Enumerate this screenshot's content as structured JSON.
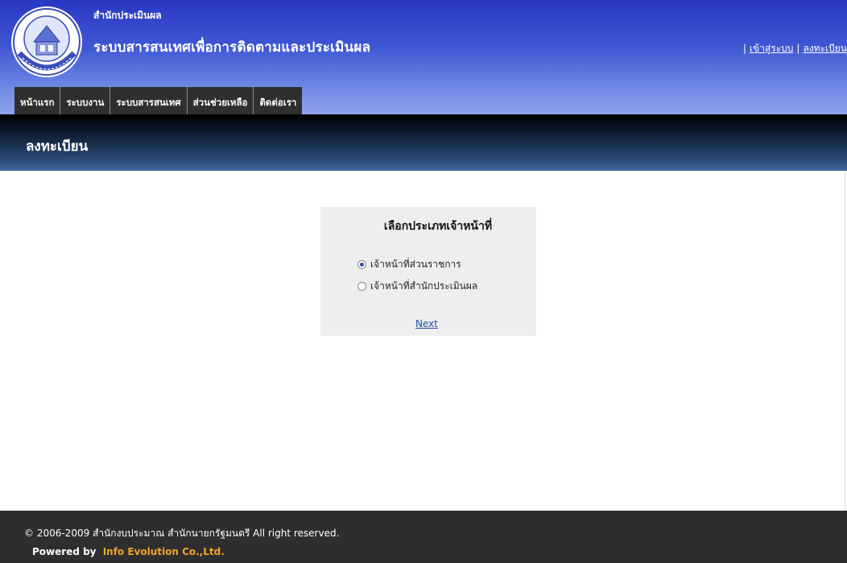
{
  "header": {
    "org_name": "สำนักประเมินผล",
    "system_title": "ระบบสารสนเทศเพื่อการติดตามและประเมินผล",
    "links": {
      "login": "เข้าสู่ระบบ",
      "register": "ลงทะเบียน",
      "separator": "|"
    }
  },
  "nav": {
    "items": [
      {
        "label": "หน้าแรก"
      },
      {
        "label": "ระบบงาน"
      },
      {
        "label": "ระบบสารสนเทศ"
      },
      {
        "label": "ส่วนช่วยเหลือ"
      },
      {
        "label": "ติดต่อเรา"
      }
    ]
  },
  "banner": {
    "title": "ลงทะเบียน"
  },
  "form": {
    "title": "เลือกประเภทเจ้าหน้าที่",
    "options": [
      {
        "label": "เจ้าหน้าที่ส่วนราชการ",
        "checked": true
      },
      {
        "label": "เจ้าหน้าที่สำนักประเมินผล",
        "checked": false
      }
    ],
    "next_label": "Next"
  },
  "footer": {
    "copyright": "© 2006-2009 สำนักงบประมาณ สำนักนายกรัฐมนตรี All right reserved.",
    "powered_by": "Powered by",
    "company": "Info Evolution Co.,Ltd."
  },
  "colors": {
    "header_top": "#2838c2",
    "header_bottom": "#8fa3ec",
    "banner_bottom": "#3f679a",
    "footer_bg": "#2e2e2e",
    "company_accent": "#f0a52a",
    "link_blue": "#1f4fa3"
  },
  "icons": {
    "logo": "budget-bureau-seal-icon",
    "radio": "radio-button-icon"
  }
}
